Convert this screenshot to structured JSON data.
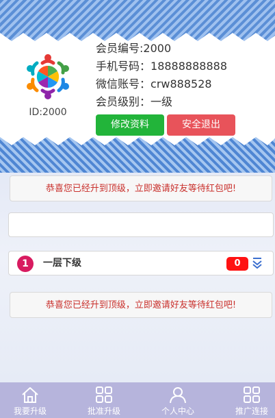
{
  "profile": {
    "id_label": "ID:2000",
    "rows": [
      {
        "key": "会员编号:",
        "value": "2000"
      },
      {
        "key": "手机号码：",
        "value": "18888888888"
      },
      {
        "key": "微信账号：",
        "value": "crw888528"
      },
      {
        "key": "会员级别：",
        "value": "一级"
      }
    ],
    "edit_button": "修改资料",
    "logout_button": "安全退出"
  },
  "notices": {
    "top": "恭喜您已经升到顶级，立即邀请好友等待红包吧!",
    "bottom": "恭喜您已经升到顶级，立即邀请好友等待红包吧!"
  },
  "level": {
    "number": "1",
    "title": "一层下级",
    "count": "0"
  },
  "tabs": [
    {
      "label": "我要升级",
      "icon": "home-icon"
    },
    {
      "label": "批准升级",
      "icon": "grid-icon"
    },
    {
      "label": "个人中心",
      "icon": "user-icon"
    },
    {
      "label": "推广连接",
      "icon": "grid-icon"
    }
  ],
  "colors": {
    "edit": "#22b43a",
    "logout": "#e8535a",
    "notice_text": "#c9302c",
    "level_badge": "#d81b60",
    "count_badge": "#ff1212",
    "tabbar": "#b6b4dc"
  }
}
